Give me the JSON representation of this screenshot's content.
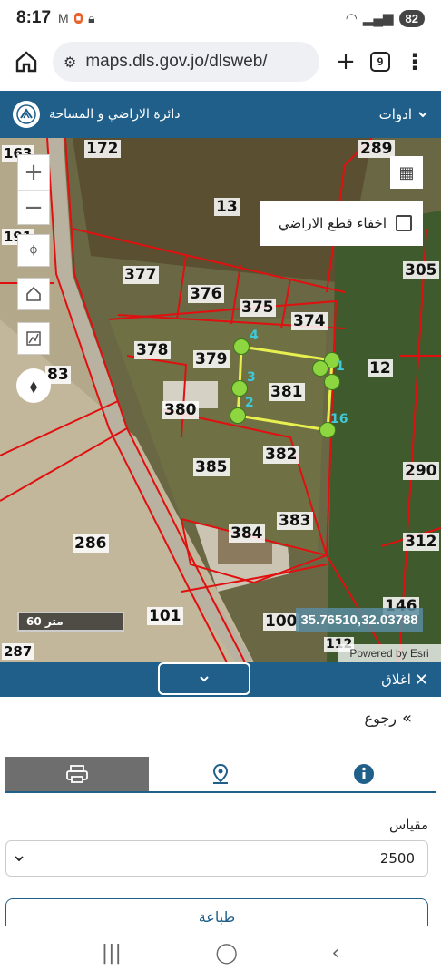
{
  "status": {
    "time": "8:17",
    "battery": "82"
  },
  "browser": {
    "url": "maps.dls.gov.jo/dlsweb/",
    "tab_count": "9"
  },
  "header": {
    "title": "دائرة الاراضي و المساحة",
    "tools_label": "ادوات"
  },
  "map": {
    "parcels": [
      "172",
      "289",
      "13",
      "305",
      "377",
      "376",
      "375",
      "374",
      "378",
      "379",
      "381",
      "12",
      "380",
      "382",
      "385",
      "290",
      "384",
      "383",
      "286",
      "312",
      "101",
      "100",
      "146",
      "287",
      "112",
      "83",
      "163",
      "191"
    ],
    "vertices": [
      "1",
      "2",
      "3",
      "4",
      "16"
    ],
    "hide_parcels_label": "اخفاء قطع الاراضي",
    "scale_text": "60 متر",
    "coordinates": "35.76510,32.03788",
    "attribution": "Powered by Esri"
  },
  "panel": {
    "close_label": "اغلاق",
    "back_label": "رجوع",
    "scale_label": "مقياس",
    "scale_value": "2500",
    "print_button": "طباعة"
  }
}
